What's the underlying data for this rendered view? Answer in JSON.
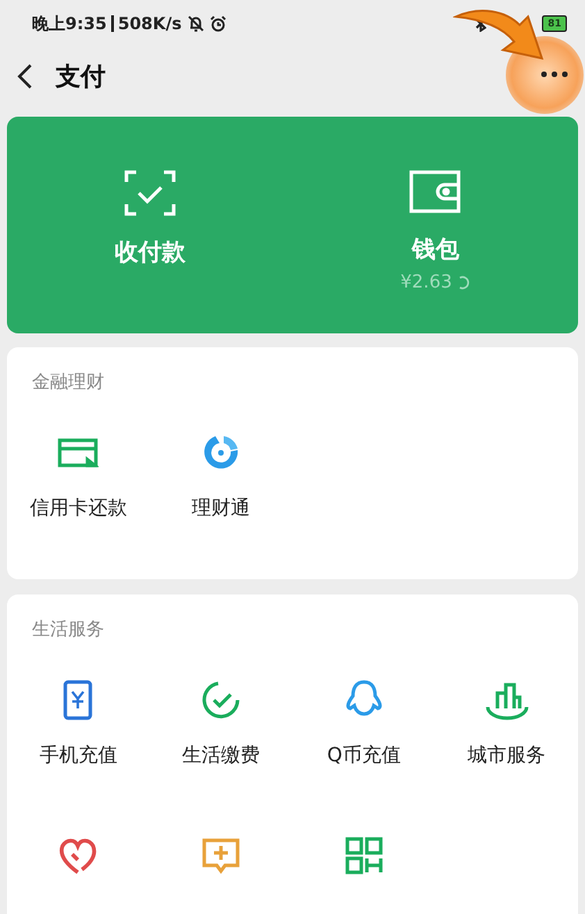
{
  "status_bar": {
    "time": "晚上9:35",
    "speed": "508K/s",
    "battery": "81"
  },
  "header": {
    "title": "支付"
  },
  "hero": [
    {
      "kind": "scan",
      "label": "收付款"
    },
    {
      "kind": "wallet",
      "label": "钱包",
      "balance": "¥2.63"
    }
  ],
  "sections": [
    {
      "title": "金融理财",
      "items": [
        {
          "kind": "card",
          "label": "信用卡还款"
        },
        {
          "kind": "licai",
          "label": "理财通"
        }
      ]
    },
    {
      "title": "生活服务",
      "items": [
        {
          "kind": "phone",
          "label": "手机充值"
        },
        {
          "kind": "bill",
          "label": "生活缴费"
        },
        {
          "kind": "qq",
          "label": "Q币充值"
        },
        {
          "kind": "city",
          "label": "城市服务"
        },
        {
          "kind": "charity"
        },
        {
          "kind": "medical"
        },
        {
          "kind": "qr"
        }
      ]
    }
  ]
}
